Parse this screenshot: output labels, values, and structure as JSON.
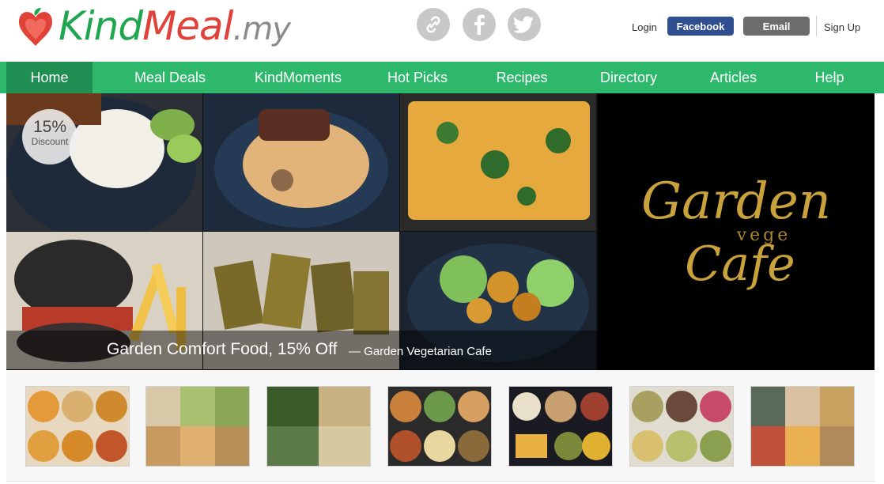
{
  "brand": {
    "logo_main": "KindMeal",
    "logo_suffix": ".my"
  },
  "social_icons": [
    "link-icon",
    "facebook-icon",
    "twitter-icon"
  ],
  "auth": {
    "login": "Login",
    "facebook": "Facebook",
    "email": "Email",
    "signup": "Sign Up"
  },
  "nav": {
    "items": [
      {
        "label": "Home",
        "active": true
      },
      {
        "label": "Meal Deals"
      },
      {
        "label": "KindMoments"
      },
      {
        "label": "Hot Picks"
      },
      {
        "label": "Recipes"
      },
      {
        "label": "Directory"
      },
      {
        "label": "Articles"
      },
      {
        "label": "Help"
      }
    ]
  },
  "hero": {
    "discount_value": "15%",
    "discount_label": "Discount",
    "title": "Garden Comfort Food, 15% Off",
    "subtitle": "— Garden Vegetarian Cafe",
    "brand_line1": "Garden",
    "brand_line2": "vege",
    "brand_line3": "Cafe"
  },
  "thumbnails_count": 7,
  "colors": {
    "nav_green": "#2db86c",
    "nav_active": "#1f8f53",
    "facebook_blue": "#2f4f91",
    "email_gray": "#6c6c6c",
    "logo_green": "#1fa64f",
    "logo_red": "#e0423a",
    "gold": "#c9a23b"
  }
}
